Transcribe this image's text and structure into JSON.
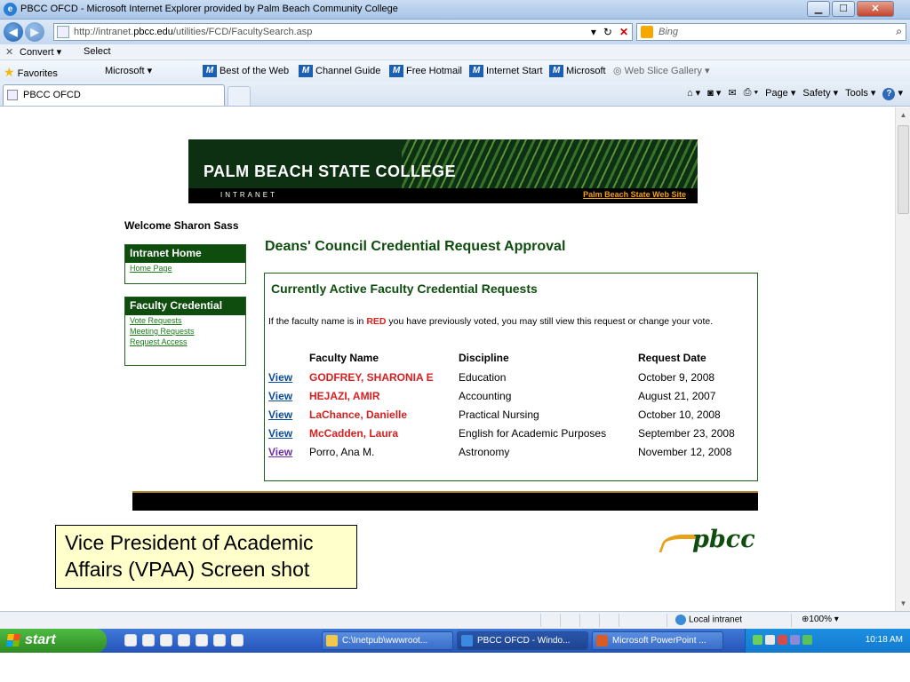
{
  "window": {
    "title": "PBCC OFCD - Microsoft Internet Explorer provided by Palm Beach Community College",
    "controls": [
      "minimize",
      "maximize",
      "close"
    ]
  },
  "address_bar": {
    "url_prefix": "http://intranet.",
    "url_host": "pbcc.edu",
    "url_path": "/utilities/FCD/FacultySearch.asp",
    "search_placeholder": "Bing"
  },
  "convert_bar": {
    "convert_label": "Convert",
    "select_label": "Select"
  },
  "favorites_bar": {
    "favorites_label": "Favorites",
    "items": [
      "Microsoft",
      "Best of the Web",
      "Channel Guide",
      "Free Hotmail",
      "Internet Start",
      "Microsoft",
      "Web Slice Gallery"
    ]
  },
  "tabs": [
    {
      "label": "PBCC OFCD"
    }
  ],
  "command_bar": {
    "page": "Page",
    "safety": "Safety",
    "tools": "Tools"
  },
  "banner": {
    "college": "PALM BEACH STATE COLLEGE",
    "intranet": "INTRANET",
    "web_link": "Palm Beach State Web Site"
  },
  "welcome": "Welcome Sharon Sass",
  "sidebar": {
    "intranet_home": {
      "title": "Intranet Home",
      "links": [
        "Home Page"
      ]
    },
    "faculty_credential": {
      "title": "Faculty Credential",
      "links": [
        "Vote Requests",
        "Meeting Requests",
        "Request Access"
      ]
    }
  },
  "main": {
    "title": "Deans' Council Credential Request Approval",
    "panel_title": "Currently Active Faculty Credential Requests",
    "note_before": "If the faculty name is in ",
    "note_red": "RED",
    "note_after": " you have previously voted, you may still view this request or change your vote.",
    "columns": [
      "",
      "Faculty Name",
      "Discipline",
      "Request Date"
    ],
    "rows": [
      {
        "link": "View",
        "name": "GODFREY, SHARONIA E",
        "discipline": "Education",
        "date": "October 9, 2008",
        "voted": true
      },
      {
        "link": "View",
        "name": "HEJAZI, AMIR",
        "discipline": "Accounting",
        "date": "August 21, 2007",
        "voted": true
      },
      {
        "link": "View",
        "name": "LaChance, Danielle",
        "discipline": "Practical Nursing",
        "date": "October 10, 2008",
        "voted": true
      },
      {
        "link": "View",
        "name": "McCadden, Laura",
        "discipline": "English for Academic Purposes",
        "date": "September 23, 2008",
        "voted": true
      },
      {
        "link": "View",
        "name": "Porro, Ana M.",
        "discipline": "Astronomy",
        "date": "November 12, 2008",
        "voted": false
      }
    ]
  },
  "callout": {
    "line1": "Vice President of Academic",
    "line2": "Affairs (VPAA) Screen shot"
  },
  "footer_logo": "pbcc",
  "status_bar": {
    "zone": "Local intranet",
    "zoom": "100%"
  },
  "taskbar": {
    "start": "start",
    "buttons": [
      "C:\\Inetpub\\wwwroot...",
      "PBCC OFCD - Windo...",
      "Microsoft PowerPoint ..."
    ],
    "clock": "10:18 AM"
  },
  "colors": {
    "green": "#0f4d0f",
    "red": "#d81f1f",
    "link": "#0b4d96",
    "gold": "#e6a21a"
  }
}
